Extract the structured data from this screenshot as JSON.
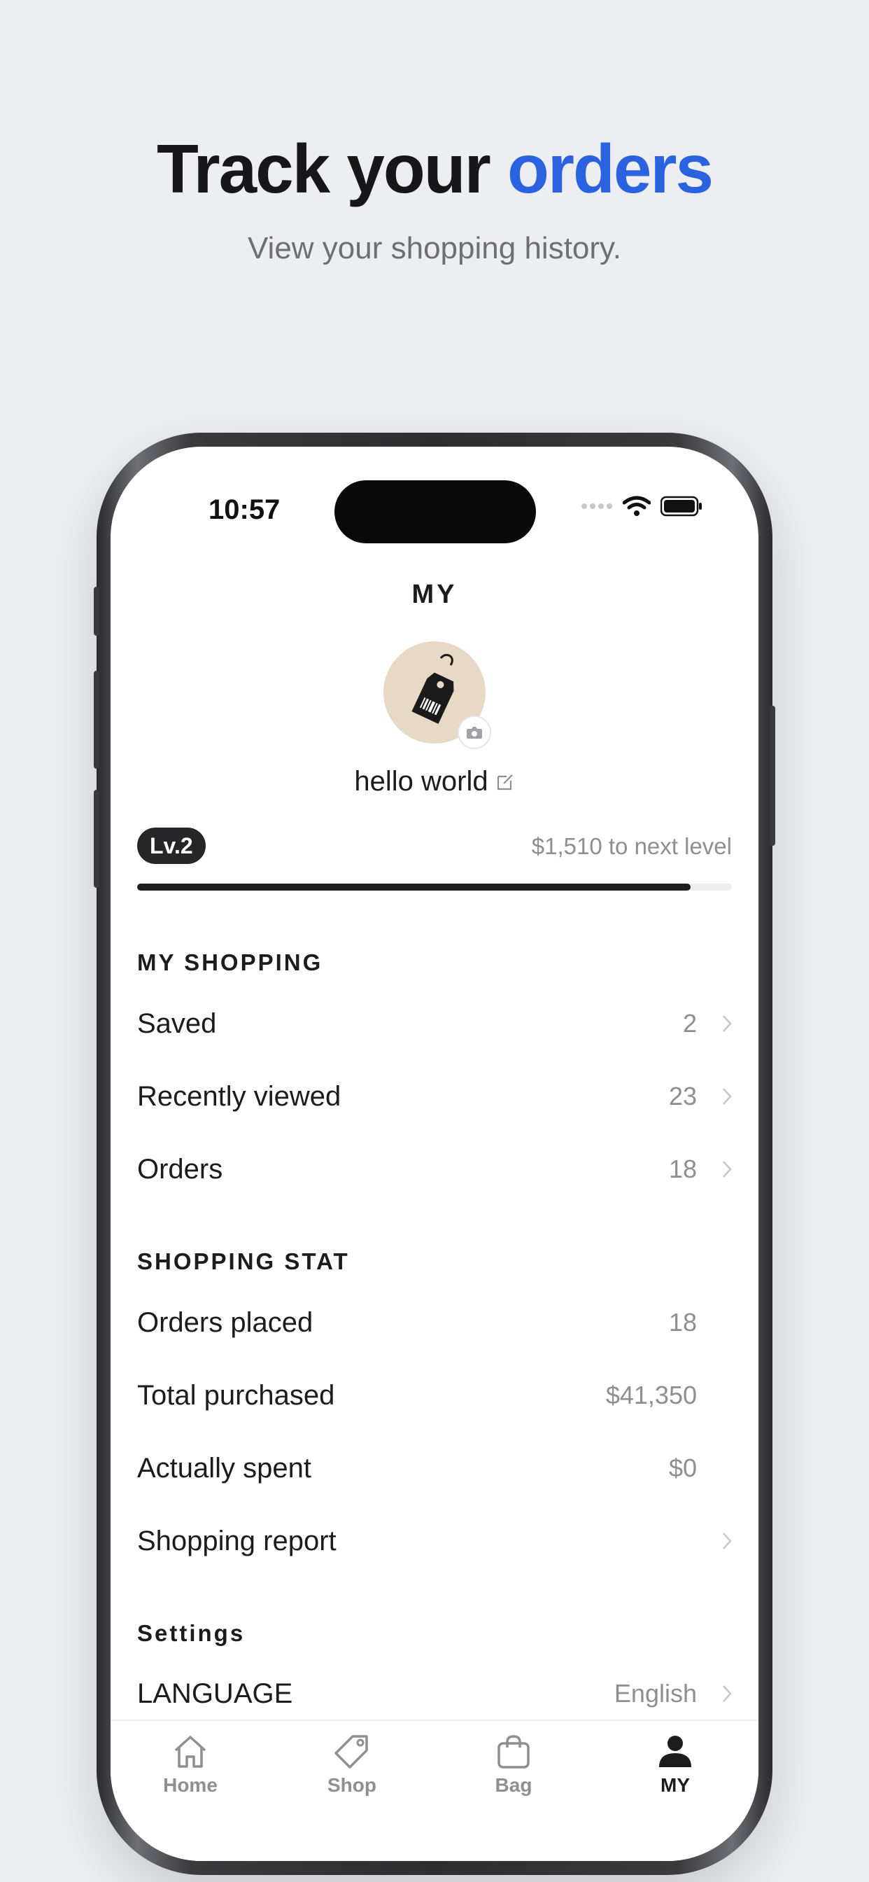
{
  "hero": {
    "title_start": "Track your ",
    "title_accent": "orders",
    "subtitle": "View your shopping history."
  },
  "status_bar": {
    "time": "10:57"
  },
  "screen": {
    "title": "MY",
    "profile": {
      "name": "hello world"
    },
    "level": {
      "badge": "Lv.2",
      "next_level_text": "$1,510 to next level",
      "progress_fraction": 0.93
    },
    "my_shopping": {
      "title": "MY SHOPPING",
      "items": [
        {
          "label": "Saved",
          "value": "2"
        },
        {
          "label": "Recently viewed",
          "value": "23"
        },
        {
          "label": "Orders",
          "value": "18"
        }
      ]
    },
    "shopping_stat": {
      "title": "SHOPPING STAT",
      "items": [
        {
          "label": "Orders placed",
          "value": "18"
        },
        {
          "label": "Total purchased",
          "value": "$41,350"
        },
        {
          "label": "Actually spent",
          "value": "$0"
        },
        {
          "label": "Shopping report",
          "value": ""
        }
      ]
    },
    "settings": {
      "title": "Settings",
      "items": [
        {
          "label": "LANGUAGE",
          "value": "English"
        }
      ]
    }
  },
  "tab_bar": {
    "tabs": [
      {
        "label": "Home",
        "icon": "home-icon"
      },
      {
        "label": "Shop",
        "icon": "tag-icon"
      },
      {
        "label": "Bag",
        "icon": "bag-icon"
      },
      {
        "label": "MY",
        "icon": "person-icon"
      }
    ],
    "active": "MY"
  },
  "colors": {
    "accent": "#2a62e0",
    "background": "#eceef2",
    "text": "#1c1c1e",
    "muted": "#8e8e93"
  }
}
